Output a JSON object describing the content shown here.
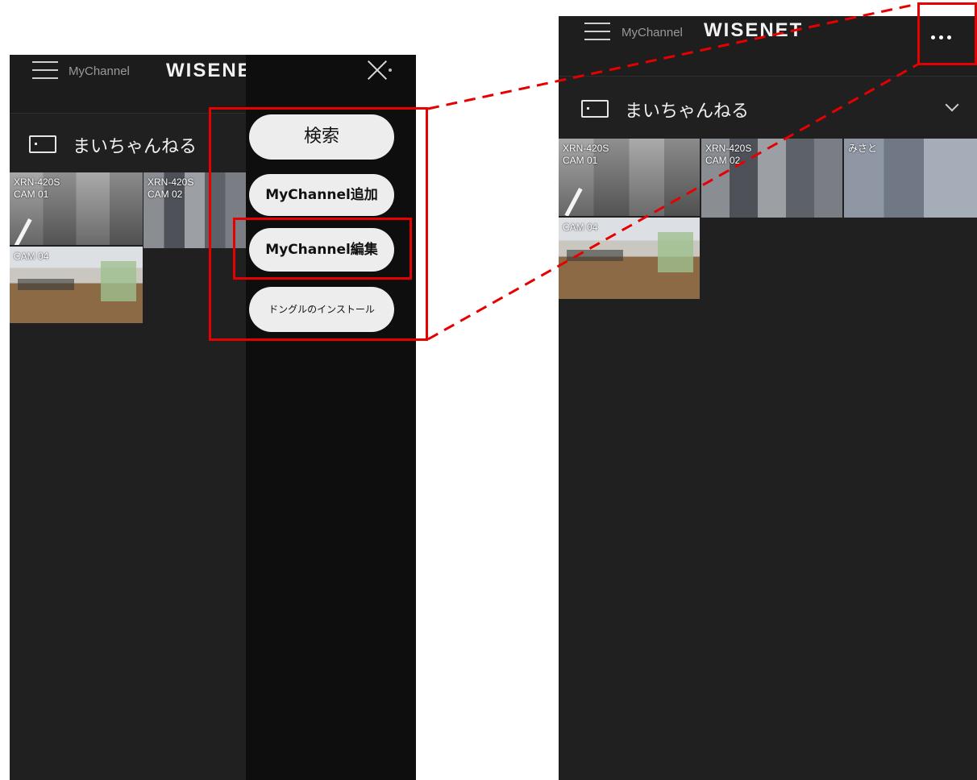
{
  "left_screen": {
    "header": {
      "section_label": "MyChannel",
      "logo_text": "WISENE"
    },
    "channel": {
      "name": "まいちゃんねる"
    },
    "cameras": [
      {
        "line1": "XRN-420S",
        "line2": "CAM 01"
      },
      {
        "line1": "XRN-420S",
        "line2": "CAM 02"
      },
      {
        "line1": "CAM 04",
        "line2": ""
      }
    ],
    "menu": {
      "search": "検索",
      "add_mychannel": "MyChannel追加",
      "edit_mychannel": "MyChannel編集",
      "install_dongle": "ドングルのインストール"
    }
  },
  "right_screen": {
    "header": {
      "section_label": "MyChannel",
      "logo_text": "WISENET"
    },
    "channel": {
      "name": "まいちゃんねる"
    },
    "cameras": [
      {
        "line1": "XRN-420S",
        "line2": "CAM 01"
      },
      {
        "line1": "XRN-420S",
        "line2": "CAM 02"
      },
      {
        "line1": "みさと",
        "line2": ""
      },
      {
        "line1": "CAM 04",
        "line2": ""
      }
    ]
  },
  "colors": {
    "highlight": "#e60000",
    "background": "#202020",
    "menu_button": "#ededed"
  }
}
